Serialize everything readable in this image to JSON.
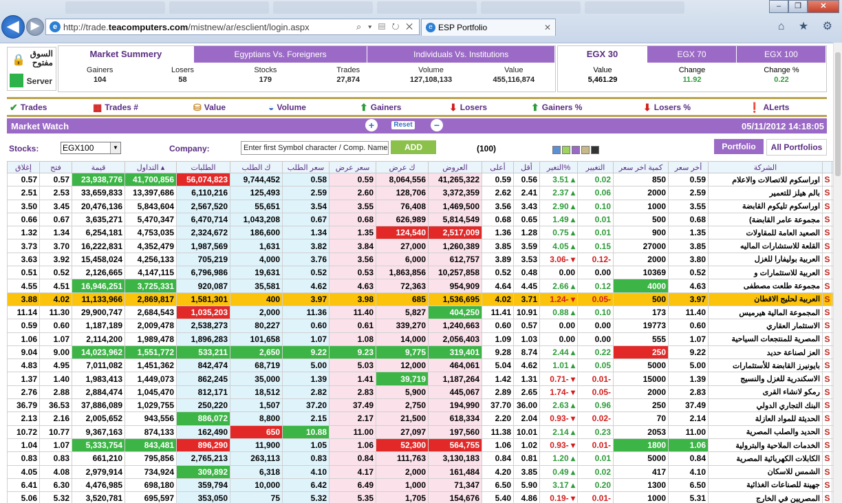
{
  "browser": {
    "url_prefix": "http://trade.",
    "url_domain": "teacomputers.com",
    "url_path": "/mistnew/ar/esclient/login.aspx",
    "url_tools": "⌕ ▾ ▤ ↻ ✕",
    "tab_title": "ESP Portfolio",
    "ie_icon": "e",
    "close_tab": "✕",
    "right_icons": "⌂ ★ ⚙",
    "win_min": "–",
    "win_max": "❐",
    "win_close": "✕",
    "back": "◀",
    "fwd": "▶"
  },
  "status": {
    "market_label": "السوق مفتوح",
    "server_label": "Server",
    "lock_icon": "🔒"
  },
  "summary": {
    "tabs": [
      "Market Summery",
      "Egyptians Vs. Foreigners",
      "Individuals Vs. Institutions"
    ],
    "headers": [
      "Gainers",
      "Losers",
      "Stocks",
      "Trades",
      "Volume",
      "Value"
    ],
    "values": [
      "104",
      "58",
      "179",
      "27,874",
      "127,108,133",
      "455,116,874"
    ]
  },
  "egx": {
    "tabs": [
      "EGX 30",
      "EGX 70",
      "EGX 100"
    ],
    "headers": [
      "Value",
      "Change",
      "Change %"
    ],
    "values": [
      "5,461.29",
      "11.92",
      "0.22"
    ]
  },
  "toolbar": {
    "items": [
      "Trades",
      "Trades #",
      "Value",
      "Volume",
      "Gainers",
      "Losers",
      "Gainers %",
      "Losers %",
      "ALerts"
    ]
  },
  "market_watch": {
    "title": "Market Watch",
    "reset": "Reset",
    "zoom_in": "+",
    "zoom_out": "−",
    "datetime": "05/11/2012 14:18:05"
  },
  "filters": {
    "stocks_label": "Stocks:",
    "stocks_value": "EGX100",
    "company_label": "Company:",
    "company_placeholder": "Enter first Symbol character / Comp. Name",
    "add_label": "ADD",
    "count": "(100)",
    "swatch_colors": [
      "#5b8fd6",
      "#9ed35c",
      "#9b6ac6",
      "#c8b98a",
      "#333333"
    ],
    "portfolio": "Portfolio",
    "all_portfolios": "All Portfolios"
  },
  "table": {
    "columns": [
      "إغلاق",
      "فتح",
      "قيمة",
      "التداول ▴",
      "الطلبات",
      "ك الطلب",
      "سعر الطلب",
      "سعر عرض",
      "ك عرض",
      "العروض",
      "أعلى",
      "أقل",
      "التغير%",
      "التغيير",
      "كمية اخر سعر",
      "أخر سعر",
      "الشركة",
      "",
      ""
    ],
    "sell_label": "S",
    "buy_label": "B",
    "rows": [
      [
        "0.57",
        "0.57",
        "23,938,776",
        "41,700,856",
        "56,074,823",
        "9,744,452",
        "0.58",
        "0.59",
        "8,064,556",
        "41,265,322",
        "0.59",
        "0.56",
        "3.51 ▴",
        "0.02",
        "850",
        "0.59",
        "اوراسكوم للاتصالات والاعلام"
      ],
      [
        "2.51",
        "2.53",
        "33,659,833",
        "13,397,686",
        "6,110,216",
        "125,493",
        "2.59",
        "2.60",
        "128,706",
        "3,372,359",
        "2.62",
        "2.41",
        "2.37 ▴",
        "0.06",
        "2000",
        "2.59",
        "بالم هيلز للتعمير"
      ],
      [
        "3.50",
        "3.45",
        "20,476,136",
        "5,843,604",
        "2,567,520",
        "55,651",
        "3.54",
        "3.55",
        "76,408",
        "1,469,500",
        "3.56",
        "3.43",
        "2.90 ▴",
        "0.10",
        "1000",
        "3.55",
        "اوراسكوم تليكوم القابضة"
      ],
      [
        "0.66",
        "0.67",
        "3,635,271",
        "5,470,347",
        "6,470,714",
        "1,043,208",
        "0.67",
        "0.68",
        "626,989",
        "5,814,549",
        "0.68",
        "0.65",
        "1.49 ▴",
        "0.01",
        "500",
        "0.68",
        "(مجموعة عامر القابضة"
      ],
      [
        "1.32",
        "1.34",
        "6,254,181",
        "4,753,035",
        "2,324,672",
        "186,600",
        "1.34",
        "1.35",
        "124,540",
        "2,517,009",
        "1.36",
        "1.28",
        "0.75 ▴",
        "0.01",
        "900",
        "1.35",
        "الصعيد العامة للمقاولات"
      ],
      [
        "3.73",
        "3.70",
        "16,222,831",
        "4,352,479",
        "1,987,569",
        "1,631",
        "3.82",
        "3.84",
        "27,000",
        "1,260,389",
        "3.85",
        "3.59",
        "4.05 ▴",
        "0.15",
        "27000",
        "3.85",
        "القلعة للاستشارات الماليه"
      ],
      [
        "3.63",
        "3.92",
        "15,458,024",
        "4,256,133",
        "705,219",
        "4,000",
        "3.76",
        "3.56",
        "6,000",
        "612,757",
        "3.89",
        "3.53",
        "3.06- ▾",
        "0.12-",
        "2000",
        "3.80",
        "العربية بوليفارا للغزل"
      ],
      [
        "0.51",
        "0.52",
        "2,126,665",
        "4,147,115",
        "6,796,986",
        "19,631",
        "0.52",
        "0.53",
        "1,863,856",
        "10,257,858",
        "0.52",
        "0.48",
        "0.00",
        "0.00",
        "10369",
        "0.52",
        "العربية للاستثمارات و"
      ],
      [
        "4.55",
        "4.51",
        "16,946,251",
        "3,725,331",
        "920,087",
        "35,581",
        "4.62",
        "4.63",
        "72,363",
        "954,909",
        "4.64",
        "4.45",
        "2.66 ▴",
        "0.12",
        "4000",
        "4.63",
        "مجموعة طلعت مصطفى"
      ],
      [
        "3.88",
        "4.02",
        "11,133,966",
        "2,869,817",
        "1,581,301",
        "400",
        "3.97",
        "3.98",
        "685",
        "1,536,695",
        "4.02",
        "3.71",
        "1.24- ▾",
        "0.05-",
        "500",
        "3.97",
        "العربية لحليج الاقطان"
      ],
      [
        "11.14",
        "11.30",
        "29,900,747",
        "2,684,543",
        "1,035,203",
        "2,000",
        "11.36",
        "11.40",
        "5,827",
        "404,250",
        "11.41",
        "10.91",
        "0.88 ▴",
        "0.10",
        "173",
        "11.40",
        "المجموعة المالية هيرميس"
      ],
      [
        "0.59",
        "0.60",
        "1,187,189",
        "2,009,478",
        "2,538,273",
        "80,227",
        "0.60",
        "0.61",
        "339,270",
        "1,240,663",
        "0.60",
        "0.57",
        "0.00",
        "0.00",
        "19773",
        "0.60",
        "الاستثمار العقاري"
      ],
      [
        "1.06",
        "1.07",
        "2,114,200",
        "1,989,478",
        "1,896,283",
        "101,658",
        "1.07",
        "1.08",
        "14,000",
        "2,056,403",
        "1.09",
        "1.03",
        "0.00",
        "0.00",
        "555",
        "1.07",
        "المصرية للمنتجعات السياحية"
      ],
      [
        "9.04",
        "9.00",
        "14,023,962",
        "1,551,772",
        "533,211",
        "2,650",
        "9.22",
        "9.23",
        "9,775",
        "319,401",
        "9.28",
        "8.74",
        "2.44 ▴",
        "0.22",
        "250",
        "9.22",
        "العز لصناعة حديد"
      ],
      [
        "4.83",
        "4.95",
        "7,011,082",
        "1,451,362",
        "842,474",
        "68,719",
        "5.00",
        "5.03",
        "12,000",
        "464,061",
        "5.04",
        "4.62",
        "1.01 ▴",
        "0.05",
        "5000",
        "5.00",
        "بايونيرز القابضة للأستثمارات"
      ],
      [
        "1.37",
        "1.40",
        "1,983,413",
        "1,449,073",
        "862,245",
        "35,000",
        "1.39",
        "1.41",
        "39,719",
        "1,187,264",
        "1.42",
        "1.31",
        "0.71- ▾",
        "0.01-",
        "15000",
        "1.39",
        "الاسكندرية للغزل والنسيج"
      ],
      [
        "2.76",
        "2.88",
        "2,884,474",
        "1,045,470",
        "812,171",
        "18,512",
        "2.82",
        "2.83",
        "5,900",
        "445,067",
        "2.89",
        "2.65",
        "1.74- ▾",
        "0.05-",
        "2000",
        "2.83",
        "رمكو لانشاء القرى"
      ],
      [
        "36.79",
        "36.53",
        "37,886,089",
        "1,029,755",
        "250,220",
        "1,507",
        "37.20",
        "37.49",
        "2,750",
        "194,990",
        "37.70",
        "36.00",
        "2.63 ▴",
        "0.96",
        "250",
        "37.49",
        "البنك التجاري الدولي"
      ],
      [
        "2.13",
        "2.16",
        "2,005,652",
        "943,556",
        "886,072",
        "8,800",
        "2.15",
        "2.17",
        "21,500",
        "618,334",
        "2.20",
        "2.04",
        "0.93- ▾",
        "0.02-",
        "70",
        "2.14",
        "الحديثة للمواد العازلة"
      ],
      [
        "10.72",
        "10.77",
        "9,367,163",
        "874,133",
        "162,490",
        "650",
        "10.88",
        "11.00",
        "27,097",
        "197,560",
        "11.38",
        "10.01",
        "2.14 ▴",
        "0.23",
        "2053",
        "11.00",
        "الحديد والصلب المصرية"
      ],
      [
        "1.04",
        "1.07",
        "5,333,754",
        "843,481",
        "896,290",
        "11,900",
        "1.05",
        "1.06",
        "52,300",
        "564,755",
        "1.06",
        "1.02",
        "0.93- ▾",
        "0.01-",
        "1800",
        "1.06",
        "الخدمات الملاحية والبترولية"
      ],
      [
        "0.83",
        "0.83",
        "661,210",
        "795,856",
        "2,765,213",
        "263,113",
        "0.83",
        "0.84",
        "111,763",
        "3,130,183",
        "0.84",
        "0.81",
        "1.20 ▴",
        "0.01",
        "5000",
        "0.84",
        "الكابلات الكهربائية المصرية"
      ],
      [
        "4.05",
        "4.08",
        "2,979,914",
        "734,924",
        "309,892",
        "6,318",
        "4.10",
        "4.17",
        "2,000",
        "161,484",
        "4.20",
        "3.85",
        "0.49 ▴",
        "0.02",
        "417",
        "4.10",
        "الشمس للاسكان"
      ],
      [
        "6.41",
        "6.30",
        "4,476,985",
        "698,180",
        "359,794",
        "10,000",
        "6.42",
        "6.49",
        "1,000",
        "71,347",
        "6.50",
        "5.90",
        "3.17 ▴",
        "0.20",
        "1300",
        "6.50",
        "جهينة للصناعات الغذائية"
      ],
      [
        "5.06",
        "5.32",
        "3,520,781",
        "695,597",
        "353,050",
        "75",
        "5.32",
        "5.35",
        "1,705",
        "154,676",
        "5.40",
        "4.86",
        "0.19- ▾",
        "0.01-",
        "1000",
        "5.31",
        "المصريين في الخارج"
      ]
    ]
  }
}
